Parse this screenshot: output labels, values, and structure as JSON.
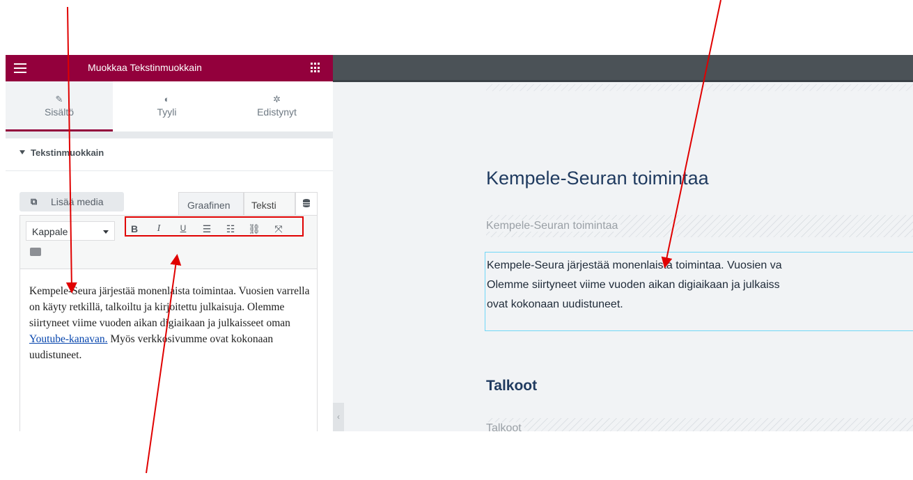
{
  "panel": {
    "header_title": "Muokkaa Tekstinmuokkain",
    "tabs": [
      {
        "label": "Sisältö",
        "icon": "pencil-icon"
      },
      {
        "label": "Tyyli",
        "icon": "contrast-icon"
      },
      {
        "label": "Edistynyt",
        "icon": "gear-icon"
      }
    ],
    "section_title": "Tekstinmuokkain",
    "add_media_label": "Lisää media",
    "mode_tabs": {
      "visual": "Graafinen",
      "text": "Teksti"
    },
    "format_select_value": "Kappale",
    "toolbar_buttons": [
      "B",
      "I",
      "U",
      "bullet-list",
      "numbered-list",
      "link",
      "fullscreen"
    ],
    "editor": {
      "text_before_link": "Kempele-Seura järjestää monenlaista toimintaa. Vuosien varrella on käyty retkillä, talkoiltu ja kirjoitettu julkaisuja. Olemme siirtyneet viime vuoden aikan digiaikaan ja julkaisseet oman ",
      "link_text": "Youtube-kanavan.",
      "text_after_link": " Myös verkkosivumme ovat kokonaan uudistuneet."
    }
  },
  "preview": {
    "heading1": "Kempele-Seuran toimintaa",
    "subtitle1": "Kempele-Seuran toimintaa",
    "paragraph_lines": [
      "Kempele-Seura järjestää monenlaista toimintaa. Vuosien va",
      "Olemme siirtyneet viime vuoden aikan digiaikaan ja julkaiss",
      "ovat kokonaan uudistuneet."
    ],
    "heading2": "Talkoot",
    "subtitle2": "Talkoot"
  },
  "colors": {
    "brand": "#93003c",
    "annotation": "#e00000",
    "selection_outline": "#71d7f7"
  }
}
